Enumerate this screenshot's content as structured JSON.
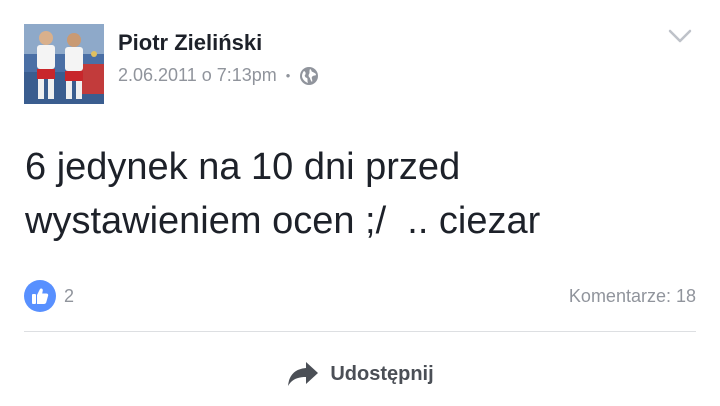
{
  "post": {
    "author": "Piotr Zieliński",
    "timestamp": "2.06.2011 o 7:13pm",
    "separator": "•",
    "privacy_icon": "globe-icon",
    "text": "6 jedynek na 10 dni przed\nwystawieniem ocen ;/  .. ciezar",
    "menu_icon": "chevron-down-icon"
  },
  "reactions": {
    "icon": "like-icon",
    "count": "2",
    "accent_color": "#5890ff"
  },
  "comments": {
    "label": "Komentarze: 18"
  },
  "actions": {
    "share_icon": "share-arrow-icon",
    "share_label": "Udostępnij"
  },
  "colors": {
    "text_primary": "#1d2129",
    "text_secondary": "#90949c",
    "divider": "#dddfe2",
    "action_text": "#4b4f56"
  }
}
